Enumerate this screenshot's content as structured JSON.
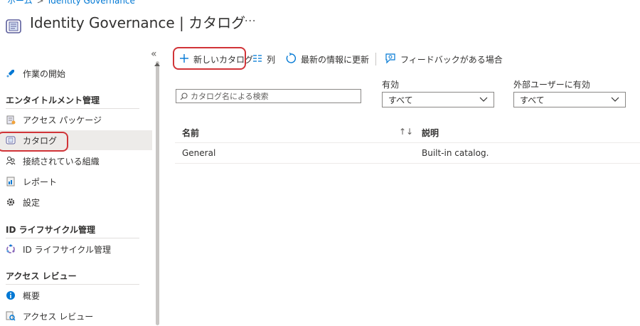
{
  "breadcrumb": {
    "home": "ホーム",
    "separator": ">",
    "current": "Identity Governance"
  },
  "page": {
    "title": "Identity Governance | カタログ",
    "more": "..."
  },
  "sidebar": {
    "collapse": "«",
    "items_top": [
      {
        "label": "作業の開始",
        "icon": "rocket-icon"
      }
    ],
    "sections": [
      {
        "heading": "エンタイトルメント管理",
        "items": [
          {
            "label": "アクセス パッケージ",
            "icon": "package-icon"
          },
          {
            "label": "カタログ",
            "icon": "catalog-icon",
            "selected": true
          },
          {
            "label": "接続されている組織",
            "icon": "people-icon"
          },
          {
            "label": "レポート",
            "icon": "report-icon"
          },
          {
            "label": "設定",
            "icon": "gear-icon"
          }
        ]
      },
      {
        "heading": "ID ライフサイクル管理",
        "items": [
          {
            "label": "ID ライフサイクル管理",
            "icon": "lifecycle-icon"
          }
        ]
      },
      {
        "heading": "アクセス レビュー",
        "items": [
          {
            "label": "概要",
            "icon": "info-icon"
          },
          {
            "label": "アクセス レビュー",
            "icon": "review-icon"
          }
        ]
      }
    ]
  },
  "toolbar": {
    "new_catalog": "新しいカタログ",
    "columns": "列",
    "refresh": "最新の情報に更新",
    "feedback": "フィードバックがある場合"
  },
  "filters": {
    "search_placeholder": "カタログ名による検索",
    "enabled_label": "有効",
    "enabled_value": "すべて",
    "external_label": "外部ユーザーに有効",
    "external_value": "すべて"
  },
  "table": {
    "headers": {
      "name": "名前",
      "sort": "↑↓",
      "description": "説明"
    },
    "rows": [
      {
        "name": "General",
        "description": "Built-in catalog."
      }
    ]
  },
  "colors": {
    "accent": "#0078d4",
    "highlight_ring": "#d13438",
    "selected_bg": "#edebe9"
  }
}
